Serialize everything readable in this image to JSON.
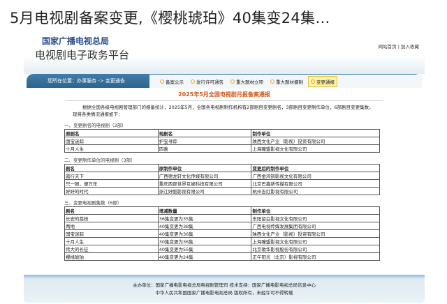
{
  "headline": "5月电视剧备案变更,《樱桃琥珀》40集变24集…",
  "header": {
    "org": "国家广播电视总局",
    "platform": "电视剧电子政务平台",
    "links": "网站首页 | 加入收藏"
  },
  "nav": {
    "location": "您所在位置：办事服务 -> 变更通告",
    "tabs": [
      {
        "label": "备案公示"
      },
      {
        "label": "发行许可通告"
      },
      {
        "label": "重大题材立项"
      },
      {
        "label": "重大题材摄制"
      },
      {
        "label": "变更通报"
      }
    ]
  },
  "doc": {
    "title": "2025年5月全国电视剧月报备案通报",
    "intro": "根据全国各级电视剧管理部门的报备统计，2025年5月，全国各电视剧制作机构有2部剧目变更剧名，3部剧目变更制作单位，6部剧目变更集数。现将各类情况通报如下：",
    "sections": [
      {
        "title": "一、变更剧名的电视剧（2部）",
        "headers": [
          "原剧名",
          "现剧名",
          "制作单位"
        ],
        "rows": [
          [
            "国宝迷踪",
            "护宝寻踪",
            "陕西文化产业（影视）投资有限公司"
          ],
          [
            "十月人生",
            "四喜",
            "上海瞳盟影视文化有限公司"
          ]
        ]
      },
      {
        "title": "二、变更制作单位的电视剧（3部）",
        "headers": [
          "剧名",
          "原制作单位",
          "变更后的制作单位"
        ],
        "rows": [
          [
            "霞行天下",
            "广西德龙轩文化传媒有限公司",
            "广西金鸿鹄影视文化有限公司"
          ],
          [
            "只一眼，便万年",
            "重庆西部世界互娱科技有限公司",
            "北京巴鑫新传媒有限公司"
          ],
          [
            "好好的时代",
            "浙江好酷影视有限公司",
            "杭州吉红影视有限公司"
          ]
        ]
      },
      {
        "title": "三、变更电视剧集数（6部）",
        "headers": [
          "剧名",
          "增减数量",
          "制作单位"
        ],
        "rows": [
          [
            "长安的荔枝",
            "36集变更为35集",
            "东阳留白影视文化有限公司"
          ],
          [
            "两地",
            "40集变更为38集",
            "广西电视传媒发展集团有限公司"
          ],
          [
            "国宝迷踪",
            "40集变更为36集",
            "陕西文化产业（影视）投资有限公司"
          ],
          [
            "十月人生",
            "30集变更为36集",
            "上海瞳盟影视文化有限公司"
          ],
          [
            "伟大的长征",
            "40集变更为55集",
            "北京歌华影视股份有限公司"
          ],
          [
            "樱桃琥珀",
            "40集变更为24集",
            "正午阳光（北京）影视有限公司"
          ]
        ]
      }
    ]
  },
  "footer": {
    "line1": "主办单位：国家广播电影电视总局电视剧管理司 技术支持：国家广播电影电视总局信息中心",
    "line2": "中华人民共和国国家广播电影电视总局 版权所有，未经许可不得转载"
  }
}
